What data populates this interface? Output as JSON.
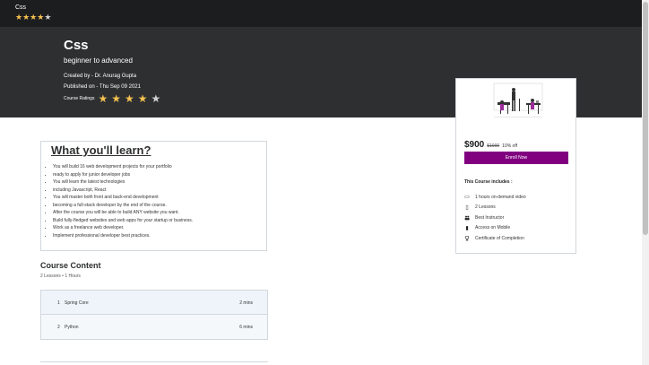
{
  "topbar": {
    "brand": "Css",
    "stars": [
      true,
      true,
      true,
      true,
      false
    ]
  },
  "hero": {
    "title": "Css",
    "subtitle": "beginner to advanced",
    "created_by": "Created by - Dr. Anurag Gupta",
    "published": "Published on - Thu Sep 09 2021",
    "ratings_label": "Course Ratings",
    "rating": 4,
    "rating_max": 5
  },
  "learn": {
    "title": "What you'll learn?",
    "items": [
      "You will build 16 web development projects for your portfolio",
      "ready to apply for junior developer jobs",
      "You will learn the latest technologies",
      "including Javascript, React",
      "You will master both front and back-end development",
      "becoming a full-stack developer by the end of the course.",
      "After the course you will be able to build ANY website you want.",
      "Build fully-fledged websites and web apps for your startup or business.",
      "Work as a freelance web developer.",
      "Implement professional developer best practices."
    ]
  },
  "content": {
    "title": "Course Content",
    "summary": "2 Lessons • 1 Hours",
    "lessons": [
      {
        "num": "1",
        "name": "Spring Core",
        "duration": "2 mins"
      },
      {
        "num": "2",
        "name": "Python",
        "duration": "6 mins"
      }
    ]
  },
  "card": {
    "price": "$900",
    "old_price": "$1000",
    "discount": "10% off",
    "enroll_label": "Enroll Now",
    "includes_title": "This Course includes :",
    "includes": [
      {
        "icon": "video-icon",
        "glyph": "▭",
        "text": "1 hours on-demand video"
      },
      {
        "icon": "file-icon",
        "glyph": "▯",
        "text": "2 Lessons"
      },
      {
        "icon": "people-icon",
        "glyph": "👥",
        "text": "Best Instructor"
      },
      {
        "icon": "mobile-icon",
        "glyph": "▮",
        "text": "Access on Mobile"
      },
      {
        "icon": "trophy-icon",
        "glyph": "🏆",
        "text": "Certificate of Completion"
      }
    ]
  },
  "colors": {
    "accent": "#800080",
    "hero_bg": "#2d2f31",
    "topbar_bg": "#1c1d1f",
    "star": "#f4c150"
  }
}
